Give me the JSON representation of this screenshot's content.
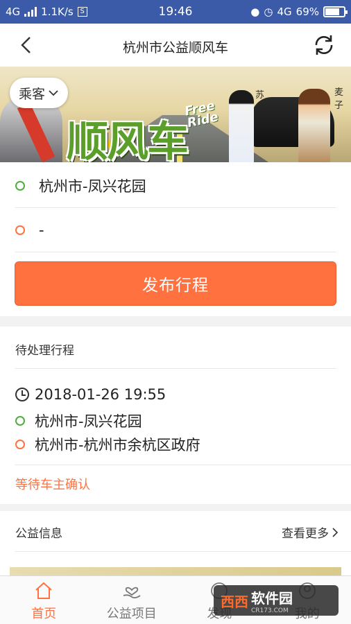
{
  "status_bar": {
    "network": "4G",
    "speed": "1.1K/s",
    "s_box": "S",
    "time": "19:46",
    "net2": "4G",
    "battery": "69%"
  },
  "header": {
    "title": "杭州市公益顺风车"
  },
  "banner": {
    "role": "乘客",
    "logo_text": "顺风车",
    "logo_en_1": "Free",
    "logo_en_2": "Ride",
    "caption_1": "苏",
    "caption_2": "麦子"
  },
  "trip_form": {
    "start": "杭州市-凤兴花园",
    "end": "-",
    "publish_label": "发布行程"
  },
  "pending": {
    "title": "待处理行程",
    "datetime": "2018-01-26 19:55",
    "from": "杭州市-凤兴花园",
    "to": "杭州市-杭州市余杭区政府",
    "status": "等待车主确认"
  },
  "welfare": {
    "title": "公益信息",
    "more_label": "查看更多"
  },
  "tabbar": {
    "items": [
      {
        "label": "首页"
      },
      {
        "label": "公益项目"
      },
      {
        "label": "发现"
      },
      {
        "label": "我的"
      }
    ]
  },
  "watermark": {
    "brand": "西西",
    "sub": "软件园",
    "url": "CR173.COM"
  },
  "colors": {
    "accent": "#ff7240",
    "green": "#4caf3c",
    "status_bar": "#3b5ba8"
  }
}
